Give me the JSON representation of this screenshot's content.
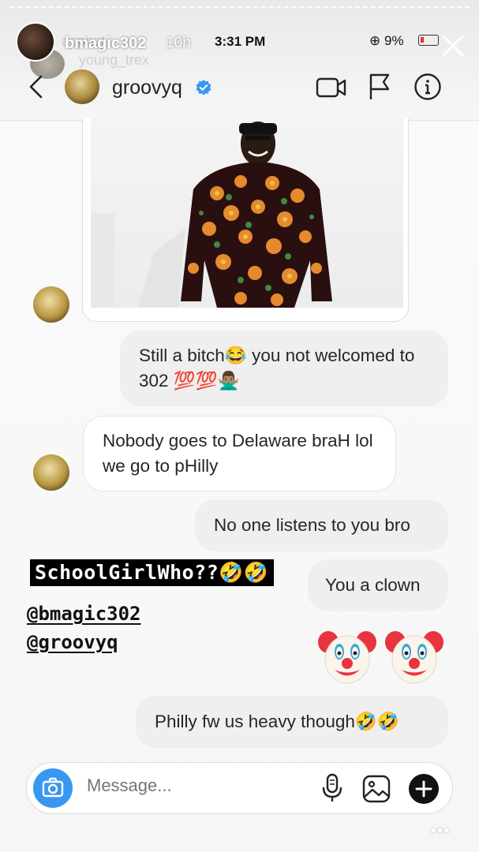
{
  "story": {
    "username": "bmagic302",
    "time_ago": "10h",
    "bg_username": "young_trex",
    "bg_app": "apphat"
  },
  "status_bar": {
    "time": "3:31 PM",
    "battery": "9%"
  },
  "chat": {
    "name": "groovyq",
    "verified": true
  },
  "messages": [
    {
      "type": "sent",
      "text": "Still a bitch😂 you not welcomed to 302 💯💯🙅🏽‍♂️"
    },
    {
      "type": "received",
      "text": "Nobody goes to Delaware braH lol we go to pHilly"
    },
    {
      "type": "sent",
      "text": "No one listens to you bro"
    },
    {
      "type": "sent",
      "text": "You a clown"
    },
    {
      "type": "sent",
      "text": "🤡🤡"
    },
    {
      "type": "sent",
      "text": "Philly fw us heavy though🤣🤣"
    }
  ],
  "sticker": {
    "text": "SchoolGirlWho??🤣🤣",
    "mentions": [
      "@bmagic302",
      "@groovyq"
    ]
  },
  "composer": {
    "placeholder": "Message..."
  },
  "more": "•••",
  "colors": {
    "accent": "#3897f0",
    "verified": "#3897f0",
    "sent_bubble": "#efefef"
  }
}
